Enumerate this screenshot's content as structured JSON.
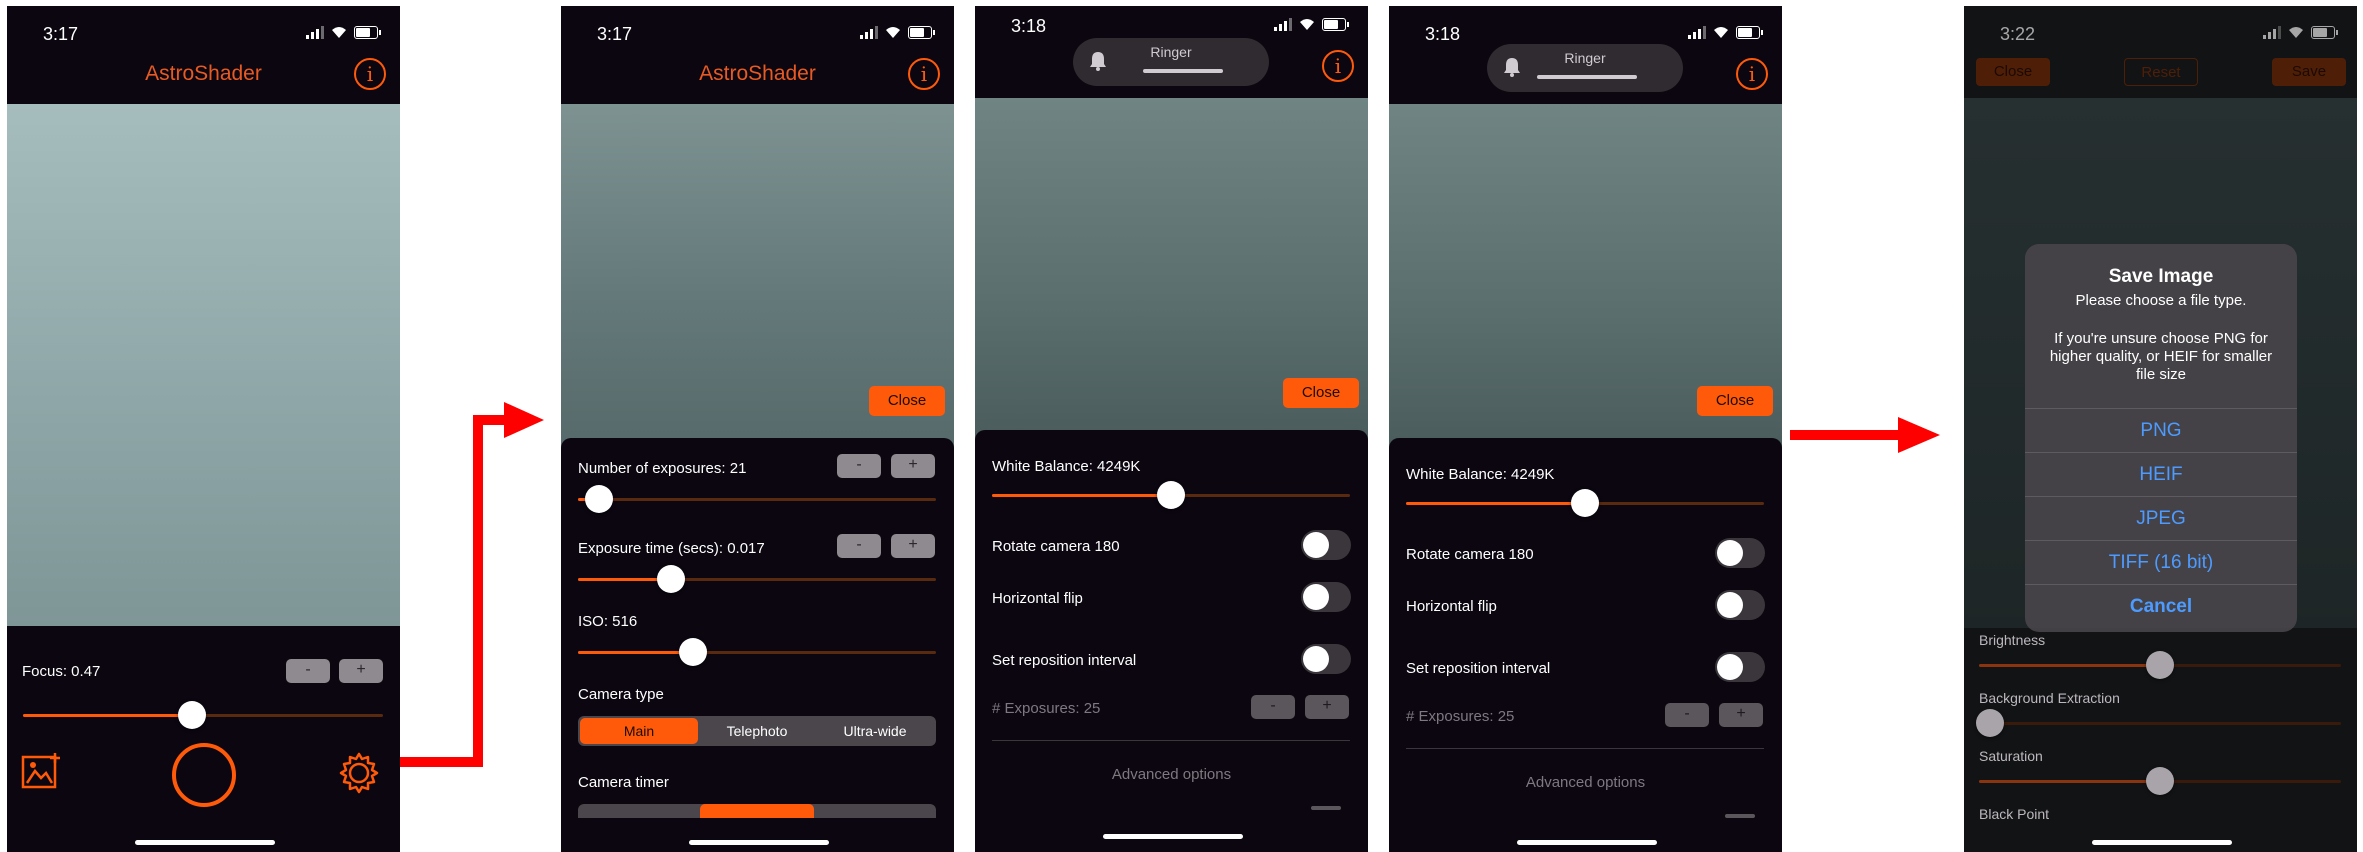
{
  "colors": {
    "accent": "#ff5a0a",
    "brand_text": "#e75a23",
    "arrow": "#ff0000",
    "link_blue": "#4d9bff"
  },
  "screens": [
    {
      "time": "3:17",
      "app_title": "AstroShader",
      "focus": {
        "label": "Focus: 0.47",
        "value": 0.47,
        "minus": "-",
        "plus": "+"
      },
      "icons": [
        "gallery-icon",
        "shutter-button",
        "settings-icon"
      ]
    },
    {
      "time": "3:17",
      "app_title": "AstroShader",
      "close_label": "Close",
      "exposures": {
        "label": "Number of exposures: 21",
        "fraction": 0.06,
        "minus": "-",
        "plus": "+"
      },
      "exposure_time": {
        "label": "Exposure time (secs): 0.017",
        "fraction": 0.26,
        "minus": "-",
        "plus": "+"
      },
      "iso": {
        "label": "ISO: 516",
        "fraction": 0.32
      },
      "camera_type": {
        "label": "Camera type",
        "options": [
          "Main",
          "Telephoto",
          "Ultra-wide"
        ],
        "selected": "Main"
      },
      "camera_timer": {
        "label": "Camera timer"
      }
    },
    {
      "time": "3:18",
      "ringer_label": "Ringer",
      "close_label": "Close",
      "white_balance": {
        "label": "White Balance: 4249K",
        "fraction": 0.5
      },
      "rotate_label": "Rotate camera 180",
      "hflip_label": "Horizontal flip",
      "reposition_label": "Set reposition interval",
      "exposures_label": "# Exposures: 25",
      "minus": "-",
      "plus": "+",
      "advanced_label": "Advanced options"
    },
    {
      "time": "3:18",
      "ringer_label": "Ringer",
      "close_label": "Close",
      "white_balance": {
        "label": "White Balance: 4249K",
        "fraction": 0.5
      },
      "rotate_label": "Rotate camera 180",
      "hflip_label": "Horizontal flip",
      "reposition_label": "Set reposition interval",
      "exposures_label": "# Exposures: 25",
      "minus": "-",
      "plus": "+",
      "advanced_label": "Advanced options"
    },
    {
      "time": "3:22",
      "close_label": "Close",
      "reset_label": "Reset",
      "save_label": "Save",
      "alert": {
        "title": "Save Image",
        "subtitle": "Please choose a file type.",
        "message_lines": [
          "If you're unsure choose PNG for",
          "higher quality, or HEIF for smaller",
          "file size"
        ],
        "options": [
          "PNG",
          "HEIF",
          "JPEG",
          "TIFF (16 bit)"
        ],
        "cancel": "Cancel"
      },
      "sliders": [
        {
          "label": "Brightness",
          "fraction": 0.5
        },
        {
          "label": "Background Extraction",
          "fraction": 0.03
        },
        {
          "label": "Saturation",
          "fraction": 0.5
        },
        {
          "label": "Black Point"
        }
      ]
    }
  ]
}
